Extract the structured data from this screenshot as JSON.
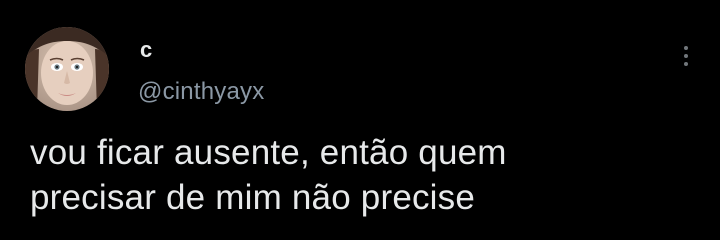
{
  "tweet": {
    "author": {
      "display_name": "c",
      "handle": "@cinthyayx",
      "avatar_icon": "profile-photo"
    },
    "text_lines": [
      "vou ficar ausente, então quem",
      "precisar de mim não precise"
    ],
    "more_icon": "more-vertical-icon"
  },
  "colors": {
    "background": "#000000",
    "primary_text": "#e7e9ea",
    "secondary_text": "#8b98a5",
    "icon": "#71767b"
  }
}
